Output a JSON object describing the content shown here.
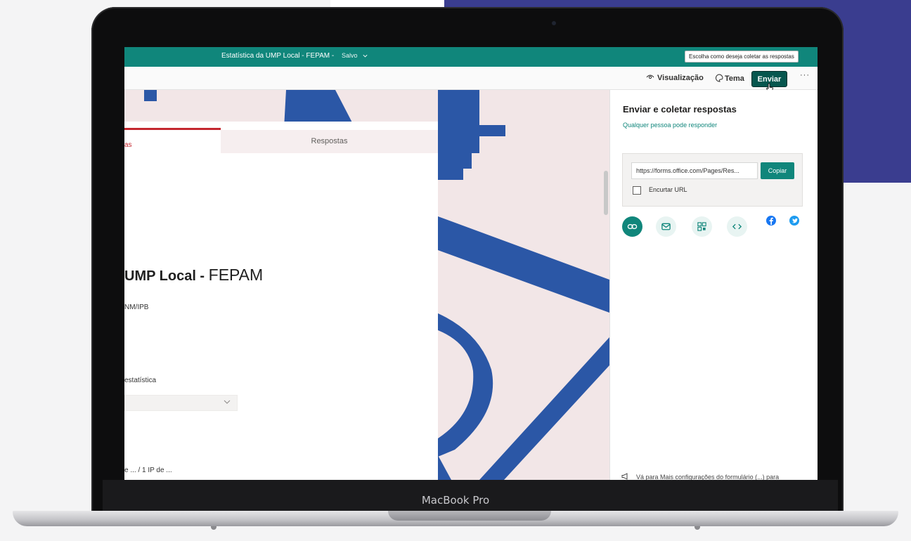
{
  "form": {
    "title": "Estatística da UMP Local - FEPAM",
    "status": "Salvo",
    "title_visible_bold": "UMP Local -",
    "title_visible_light": "FEPAM",
    "subtitle_partial": "NM/IPB",
    "tabs": {
      "questions_partial": "as",
      "responses": "Respostas"
    },
    "question1_label_partial": "estatística",
    "question2_label_partial": "e ...  / 1 IP de ..."
  },
  "toolbar": {
    "preview_label": "Visualização",
    "theme_label": "Tema",
    "send_label": "Enviar",
    "more_label": "···",
    "tooltip": "Escolha como deseja coletar as respostas"
  },
  "send_panel": {
    "heading": "Enviar e coletar respostas",
    "audience": "Qualquer pessoa pode responder",
    "link_url": "https://forms.office.com/Pages/Res...",
    "copy_label": "Copiar",
    "shorten_label": "Encurtar URL",
    "shorten_checked": false,
    "share_methods": [
      "link-icon",
      "mail-icon",
      "qr-code-icon",
      "embed-icon"
    ],
    "social": [
      "facebook-icon",
      "twitter-icon"
    ],
    "footer_note": "Vá para Mais configurações do formulário (...) para"
  },
  "device": {
    "brand": "MacBook Pro"
  },
  "colors": {
    "header_teal": "#10867b",
    "send_button": "#07574f",
    "tab_red": "#c4262e",
    "theme_blue": "#2b57a6",
    "background_purple": "#3a3d8f",
    "facebook": "#1877f2",
    "twitter": "#1d9bf0"
  }
}
